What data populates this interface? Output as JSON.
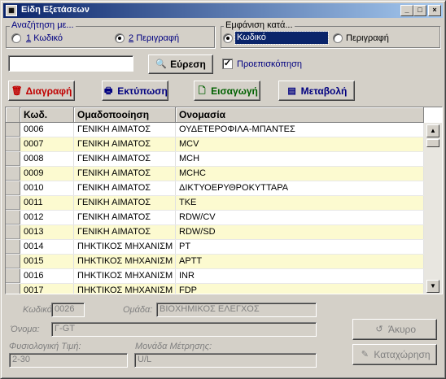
{
  "window": {
    "title": "Είδη Εξετάσεων",
    "icon": "app-icon"
  },
  "search_group": {
    "label": "Αναζήτηση με...",
    "options": [
      {
        "num": "1",
        "label": "Κωδικό",
        "selected": false
      },
      {
        "num": "2",
        "label": "Περιγραφή",
        "selected": true
      }
    ]
  },
  "display_group": {
    "label": "Εμφάνιση κατά...",
    "options": [
      {
        "label": "Κωδικό",
        "selected": true
      },
      {
        "label": "Περιγραφή",
        "selected": false
      }
    ]
  },
  "search": {
    "value": "",
    "button": "Εύρεση"
  },
  "preview": {
    "label": "Προεπισκόπηση",
    "checked": true
  },
  "toolbar": {
    "delete": "Διαγραφή",
    "print": "Εκτύπωση",
    "insert": "Εισαγωγή",
    "edit": "Μεταβολή"
  },
  "colors": {
    "delete": "#c00000",
    "print": "#000080",
    "insert": "#006000",
    "edit": "#000080",
    "row_alt": "#fcfad0"
  },
  "table": {
    "headers": [
      "Κωδ.",
      "Ομαδοποοίηση",
      "Ονομασία"
    ],
    "rows": [
      [
        "0006",
        "ΓΕΝΙΚΗ ΑΙΜΑΤΟΣ",
        "ΟΥΔΕΤΕΡΟΦΙΛΑ-ΜΠΑΝΤΕΣ"
      ],
      [
        "0007",
        "ΓΕΝΙΚΗ ΑΙΜΑΤΟΣ",
        "MCV"
      ],
      [
        "0008",
        "ΓΕΝΙΚΗ ΑΙΜΑΤΟΣ",
        "MCH"
      ],
      [
        "0009",
        "ΓΕΝΙΚΗ ΑΙΜΑΤΟΣ",
        "MCHC"
      ],
      [
        "0010",
        "ΓΕΝΙΚΗ ΑΙΜΑΤΟΣ",
        "ΔΙΚΤΥΟΕΡΥΘΡΟΚΥΤΤΑΡΑ"
      ],
      [
        "0011",
        "ΓΕΝΙΚΗ ΑΙΜΑΤΟΣ",
        "ΤΚΕ"
      ],
      [
        "0012",
        "ΓΕΝΙΚΗ ΑΙΜΑΤΟΣ",
        "RDW/CV"
      ],
      [
        "0013",
        "ΓΕΝΙΚΗ ΑΙΜΑΤΟΣ",
        "RDW/SD"
      ],
      [
        "0014",
        "ΠΗΚΤΙΚΟΣ ΜΗΧΑΝΙΣΜ",
        "PT"
      ],
      [
        "0015",
        "ΠΗΚΤΙΚΟΣ ΜΗΧΑΝΙΣΜ",
        "APTT"
      ],
      [
        "0016",
        "ΠΗΚΤΙΚΟΣ ΜΗΧΑΝΙΣΜ",
        "INR"
      ],
      [
        "0017",
        "ΠΗΚΤΙΚΟΣ ΜΗΧΑΝΙΣΜ",
        "FDP"
      ]
    ]
  },
  "details": {
    "code_label": "Κωδικός:",
    "code_value": "0026",
    "group_label": "Ομάδα:",
    "group_value": "ΒΙΟΧΗΜΙΚΟΣ ΕΛΕΓΧΟΣ",
    "name_label": "Όνομα:",
    "name_value": "Γ-GT",
    "normal_label": "Φυσιολογική Τιμή:",
    "normal_value": "2-30",
    "unit_label": "Μονάδα Μέτρησης:",
    "unit_value": "U/L"
  },
  "actions": {
    "cancel": "Άκυρο",
    "save": "Καταχώρηση"
  }
}
